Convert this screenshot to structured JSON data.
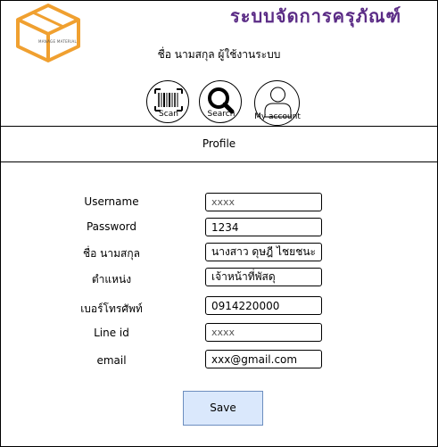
{
  "header": {
    "app_title": "ระบบจัดการครุภัณฑ์",
    "logo_text": "MANAGE MATERIAL",
    "user_name": "ชื่อ นามสกุล ผู้ใช้งานระบบ"
  },
  "toolbar": {
    "scan_label": "Scan",
    "search_label": "Search",
    "account_label": "My account"
  },
  "tabs": {
    "profile_label": "Profile"
  },
  "form": {
    "fields": [
      {
        "label": "Username",
        "value": "xxxx"
      },
      {
        "label": "Password",
        "value": "1234"
      },
      {
        "label": "ชื่อ นามสกุล",
        "value": "นางสาว ดุษฎี ไชยชนะ"
      },
      {
        "label": "ตำแหน่ง",
        "value": "เจ้าหน้าที่พัสดุ"
      },
      {
        "label": "เบอร์โทรศัพท์",
        "value": "0914220000"
      },
      {
        "label": "Line id",
        "value": "xxxx"
      },
      {
        "label": "email",
        "value": "xxx@gmail.com"
      }
    ],
    "save_label": "Save"
  },
  "colors": {
    "title": "#5b2c86",
    "logo": "#f0a030",
    "save_fill": "#dae8fc",
    "save_border": "#6c8ebf"
  }
}
